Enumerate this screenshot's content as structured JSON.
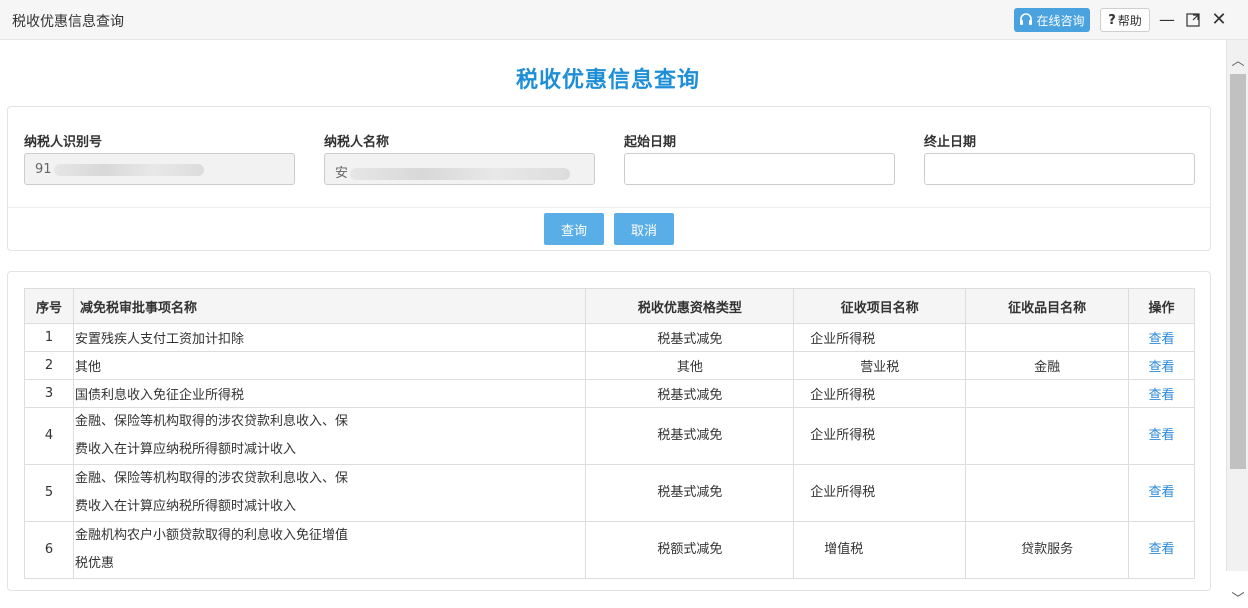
{
  "window": {
    "title": "税收优惠信息查询",
    "consult_label": "在线咨询",
    "help_label": "帮助"
  },
  "page": {
    "title": "税收优惠信息查询"
  },
  "search": {
    "fields": [
      {
        "label": "纳税人识别号",
        "value": "91",
        "readonly": true
      },
      {
        "label": "纳税人名称",
        "value": "安",
        "readonly": true
      },
      {
        "label": "起始日期",
        "value": "",
        "readonly": false
      },
      {
        "label": "终止日期",
        "value": "",
        "readonly": false
      }
    ],
    "query_label": "查询",
    "cancel_label": "取消"
  },
  "table": {
    "headers": [
      "序号",
      "减免税审批事项名称",
      "税收优惠资格类型",
      "征收项目名称",
      "征收品目名称",
      "操作"
    ],
    "rows": [
      {
        "no": "1",
        "name_1": "安置残疾人支付工资加计扣除",
        "name_2": "",
        "type": "税基式减免",
        "item": "企业所得税",
        "category": "",
        "action": "查看"
      },
      {
        "no": "2",
        "name_1": "其他",
        "name_2": "",
        "type": "其他",
        "item": "营业税",
        "category": "金融",
        "action": "查看"
      },
      {
        "no": "3",
        "name_1": "国债利息收入免征企业所得税",
        "name_2": "",
        "type": "税基式减免",
        "item": "企业所得税",
        "category": "",
        "action": "查看"
      },
      {
        "no": "4",
        "name_1": "金融、保险等机构取得的涉农贷款利息收入、保",
        "name_2": "费收入在计算应纳税所得额时减计收入",
        "type": "税基式减免",
        "item": "企业所得税",
        "category": "",
        "action": "查看"
      },
      {
        "no": "5",
        "name_1": "金融、保险等机构取得的涉农贷款利息收入、保",
        "name_2": "费收入在计算应纳税所得额时减计收入",
        "type": "税基式减免",
        "item": "企业所得税",
        "category": "",
        "action": "查看"
      },
      {
        "no": "6",
        "name_1": "金融机构农户小额贷款取得的利息收入免征增值",
        "name_2": "税优惠",
        "type": "税额式减免",
        "item": "增值税",
        "category": "贷款服务",
        "action": "查看"
      }
    ]
  }
}
